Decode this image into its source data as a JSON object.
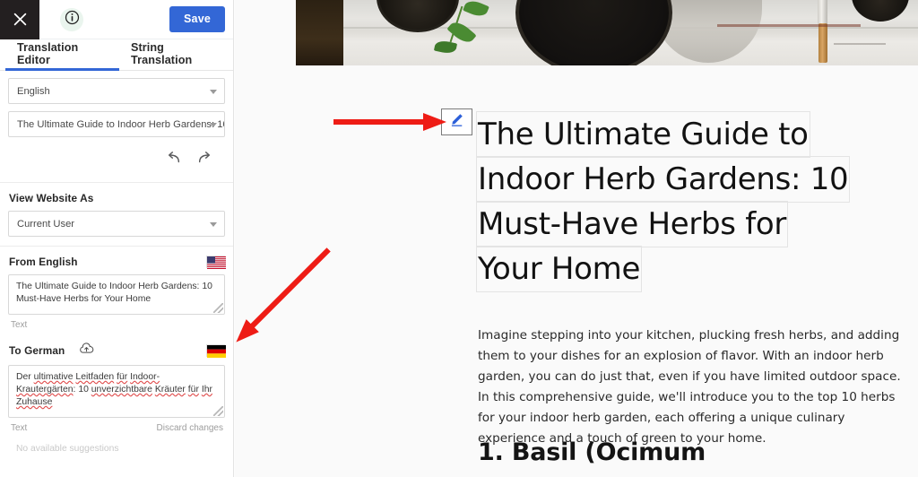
{
  "sidebar": {
    "topbar": {
      "close_icon": "close-icon",
      "info_icon": "info-icon",
      "save_label": "Save"
    },
    "tabs": [
      {
        "label": "Translation Editor",
        "active": true
      },
      {
        "label": "String Translation",
        "active": false
      }
    ],
    "language_select": {
      "value": "English",
      "caret_icon": "chevron-down-icon"
    },
    "string_select": {
      "value": "The Ultimate Guide to Indoor Herb Gardens: 10 M...",
      "caret_icon": "chevron-down-icon"
    },
    "history": {
      "undo_icon": "undo-arrow-icon",
      "redo_icon": "redo-arrow-icon"
    },
    "view_website_as": {
      "title": "View Website As",
      "value": "Current User",
      "caret_icon": "chevron-down-icon"
    },
    "source": {
      "title": "From English",
      "flag_icon": "us-flag-icon",
      "text": "The Ultimate Guide to Indoor Herb Gardens: 10 Must-Have Herbs for Your Home",
      "field_label": "Text"
    },
    "target": {
      "title": "To German",
      "cloud_icon": "cloud-upload-icon",
      "flag_icon": "german-flag-icon",
      "text_part1": "Der ",
      "text_sp1": "ultimative",
      "text_sp2": "Leitfaden",
      "text_sp3": "für",
      "text_sp4": "Indoor-Krautergärten",
      "text_mid": ": 10 ",
      "text_sp5": "unverzichtbare",
      "text_sp6": "Kräuter",
      "text_sp7": "für",
      "text_sp8": "Ihr",
      "text_sp9": "Zuhause",
      "field_label": "Text",
      "discard_label": "Discard changes",
      "suggestions_label": "No available suggestions"
    }
  },
  "content": {
    "hero_alt": "indoor herb garden pots photo",
    "edit_icon": "pencil-edit-icon",
    "title_lines": [
      "The Ultimate Guide to",
      "Indoor Herb Gardens: 10",
      "Must-Have Herbs for",
      "Your Home"
    ],
    "paragraph": "Imagine stepping into your kitchen, plucking fresh herbs, and adding them to your dishes for an explosion of flavor. With an indoor herb garden, you can do just that, even if you have limited outdoor space. In this comprehensive guide, we'll introduce you to the top 10 herbs for your indoor herb garden, each offering a unique culinary experience and a touch of green to your home.",
    "subheading": "1. Basil (Ocimum"
  },
  "annotations": {
    "arrow_to_edit_icon": "red-arrow-icon",
    "arrow_to_german_field": "red-arrow-icon"
  },
  "colors": {
    "accent_blue": "#3367d6",
    "close_bg": "#231f20",
    "spellcheck_red": "#e04a4a",
    "annotation_red": "#ee1c15",
    "content_bg": "#fafafa"
  }
}
